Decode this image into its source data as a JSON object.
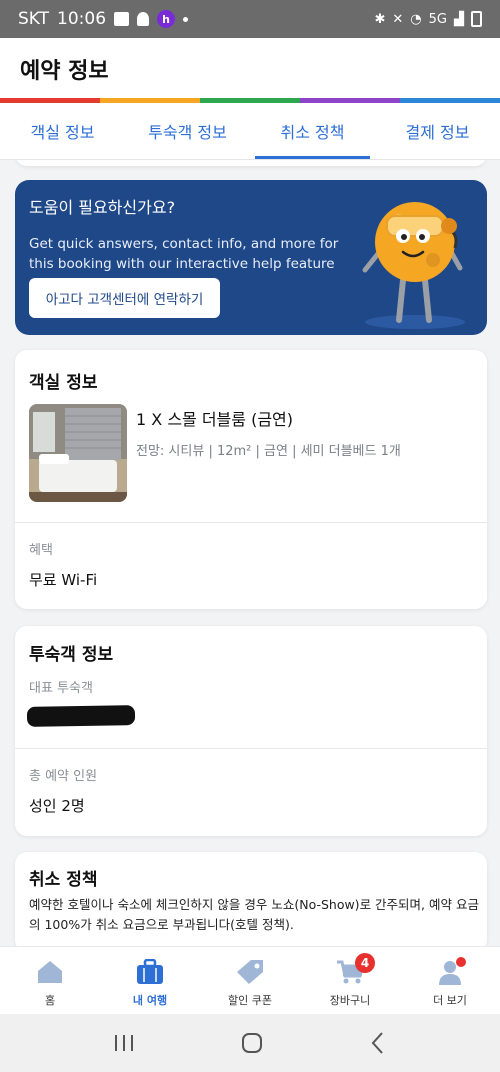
{
  "status_bar": {
    "carrier": "SKT",
    "time": "10:06",
    "network": "5G"
  },
  "header": {
    "title": "예약 정보"
  },
  "colors": {
    "accent": "#2e6fd6",
    "banner": "#1f4889",
    "rainbow": [
      "#e33b2e",
      "#f5a623",
      "#2ea84f",
      "#8e44c9",
      "#2e86d6"
    ]
  },
  "tabs": [
    {
      "label": "객실 정보"
    },
    {
      "label": "투숙객 정보"
    },
    {
      "label": "취소 정책",
      "active": true
    },
    {
      "label": "결제 정보"
    }
  ],
  "help": {
    "title": "도움이 필요하신가요?",
    "description": "Get quick answers, contact info, and more for this booking with our interactive help feature",
    "button_label": "아고다 고객센터에 연락하기"
  },
  "room_card": {
    "title": "객실 정보",
    "room_name": "1 X 스몰 더블룸 (금연)",
    "room_desc": "전망: 시티뷰 | 12m² | 금연 | 세미 더블베드 1개",
    "benefit_label": "혜택",
    "benefit_value": "무료 Wi-Fi"
  },
  "guest_card": {
    "title": "투숙객 정보",
    "lead_guest_label": "대표 투숙객",
    "total_label": "총 예약 인원",
    "total_value": "성인 2명"
  },
  "cancel_card": {
    "title": "취소 정책",
    "body": "예약한 호텔이나 숙소에 체크인하지 않을 경우 노쇼(No-Show)로 간주되며, 예약 요금의 100%가 취소 요금으로 부과됩니다(호텔 정책)."
  },
  "bottom_nav": [
    {
      "label": "홈",
      "icon": "home-icon"
    },
    {
      "label": "내 여행",
      "icon": "suitcase-icon",
      "active": true
    },
    {
      "label": "할인 쿠폰",
      "icon": "tag-icon"
    },
    {
      "label": "장바구니",
      "icon": "cart-icon",
      "badge": "4"
    },
    {
      "label": "더 보기",
      "icon": "profile-icon"
    }
  ]
}
